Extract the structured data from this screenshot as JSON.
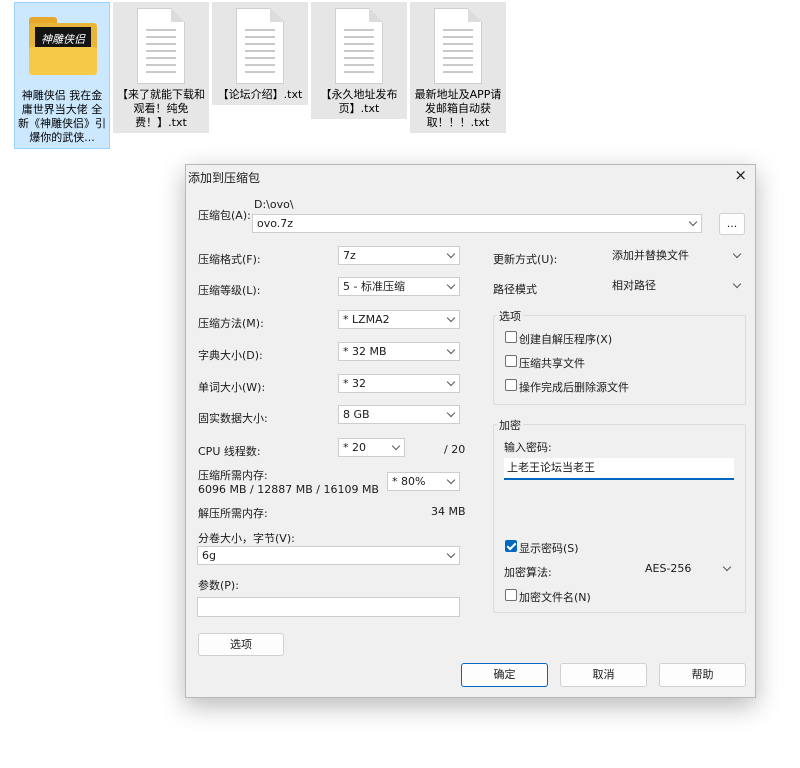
{
  "files": [
    {
      "name": "神雕侠侣 我在金庸世界当大佬 全新《神雕侠侣》引爆你的武侠...",
      "selected": true,
      "type": "folder",
      "thumb_text": "神雕侠侣"
    },
    {
      "name": "【来了就能下载和观看！纯免费！】.txt",
      "type": "txt"
    },
    {
      "name": "【论坛介绍】.txt",
      "type": "txt"
    },
    {
      "name": "【永久地址发布页】.txt",
      "type": "txt"
    },
    {
      "name": "最新地址及APP请发邮箱自动获取！！！.txt",
      "type": "txt"
    }
  ],
  "dialog": {
    "title": "添加到压缩包",
    "close_icon": "×",
    "archive_label": "压缩包(A):",
    "archive_path": "D:\\ovo\\",
    "archive_name": "ovo.7z",
    "browse_label": "...",
    "format_label": "压缩格式(F):",
    "format_value": "7z",
    "level_label": "压缩等级(L):",
    "level_value": "5 - 标准压缩",
    "method_label": "压缩方法(M):",
    "method_value": "* LZMA2",
    "dict_label": "字典大小(D):",
    "dict_value": "* 32 MB",
    "word_label": "单词大小(W):",
    "word_value": "* 32",
    "solid_label": "固实数据大小:",
    "solid_value": "8 GB",
    "cpu_label": "CPU 线程数:",
    "cpu_value": "* 20",
    "cpu_max": "/ 20",
    "mem_comp_label": "压缩所需内存:",
    "mem_comp_value": "6096 MB / 12887 MB / 16109 MB",
    "mem_percent": "* 80%",
    "mem_decomp_label": "解压所需内存:",
    "mem_decomp_value": "34 MB",
    "split_label": "分卷大小，字节(V):",
    "split_value": "6g",
    "params_label": "参数(P):",
    "params_value": "",
    "options_button": "选项",
    "update_label": "更新方式(U):",
    "update_value": "添加并替换文件",
    "path_label": "路径模式",
    "path_value": "相对路径",
    "options_group": "选项",
    "opt_sfx": "创建自解压程序(X)",
    "opt_shared": "压缩共享文件",
    "opt_delete": "操作完成后删除源文件",
    "enc_group": "加密",
    "enc_pwd_label": "输入密码:",
    "enc_pwd_value": "上老王论坛当老王",
    "show_pwd": "显示密码(S)",
    "enc_method_label": "加密算法:",
    "enc_method_value": "AES-256",
    "enc_names": "加密文件名(N)",
    "ok": "确定",
    "cancel": "取消",
    "help": "帮助"
  }
}
